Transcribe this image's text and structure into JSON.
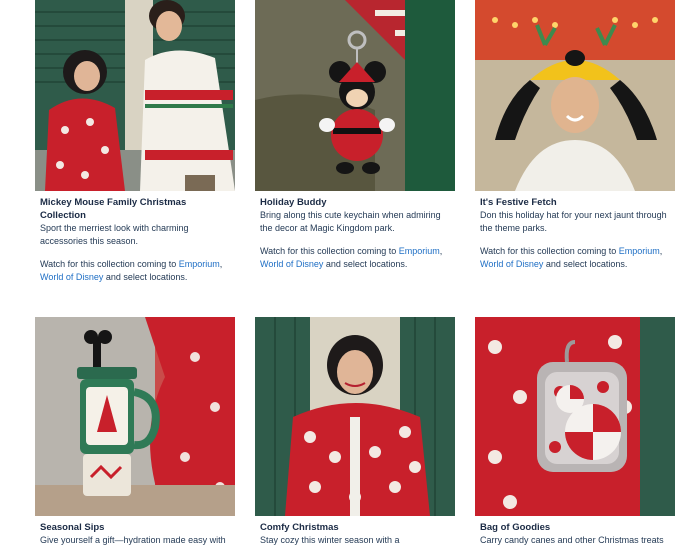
{
  "colors": {
    "link": "#1f6fc5",
    "text": "#253b56",
    "title": "#1b2b45"
  },
  "note": {
    "prefix": "Watch for this collection coming to ",
    "link1": "Emporium",
    "comma": ",",
    "link2": "World of Disney",
    "suffix": " and select locations."
  },
  "cards": [
    {
      "title": "Mickey Mouse Family Christmas Collection",
      "desc": "Sport the merriest look with charming accessories this season."
    },
    {
      "title": "Holiday Buddy",
      "desc": "Bring along this cute keychain when admiring the decor at Magic Kingdom park."
    },
    {
      "title": "It's Festive Fetch",
      "desc": "Don this holiday hat for your next jaunt through the theme parks."
    },
    {
      "title": "Seasonal Sips",
      "desc": "Give yourself a gift—hydration made easy with"
    },
    {
      "title": "Comfy Christmas",
      "desc": "Stay cozy this winter season with a"
    },
    {
      "title": "Bag of Goodies",
      "desc": "Carry candy canes and other Christmas treats"
    }
  ]
}
